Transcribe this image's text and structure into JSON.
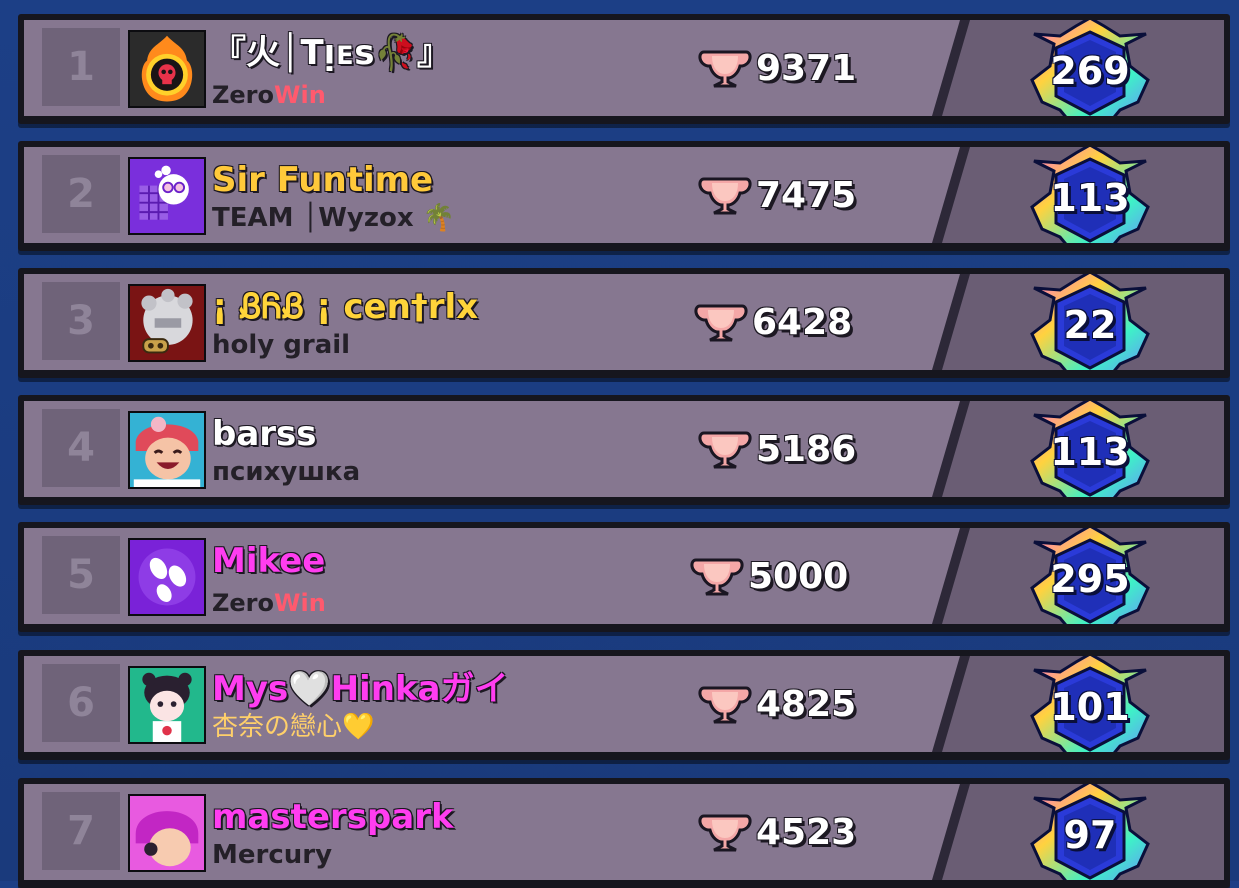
{
  "leaderboard": {
    "rows": [
      {
        "rank": "1",
        "name": "『火│Tᴉᴇs🥀』",
        "name_color": "#ffffff",
        "club": "ZeroWin",
        "club_parts": [
          "Zero",
          "Win"
        ],
        "club_colors": [
          "#242028",
          "#ff5a6e"
        ],
        "trophies": "9371",
        "level": "269",
        "avatar_icon": "flaming-skull-icon"
      },
      {
        "rank": "2",
        "name_parts": [
          "Sir ",
          "Funtime"
        ],
        "name_colors": [
          "#ffc93a",
          "#ffc93a"
        ],
        "club": "TEAM │Wyzox 🌴",
        "club_color": "#242028",
        "trophies": "7475",
        "level": "113",
        "avatar_icon": "purple-character-icon"
      },
      {
        "rank": "3",
        "name_parts": [
          "¡ ᏰᏲᏰ ¡ ",
          "cen†rlx"
        ],
        "name_colors": [
          "#ffd43a",
          "#ffd43a"
        ],
        "club": "holy grail",
        "club_color": "#242028",
        "trophies": "6428",
        "level": "22",
        "avatar_icon": "robot-brawler-icon"
      },
      {
        "rank": "4",
        "name": "barss",
        "name_color": "#ffffff",
        "club": "психушка",
        "club_color": "#242028",
        "trophies": "5186",
        "level": "113",
        "avatar_icon": "laughing-brawler-icon"
      },
      {
        "rank": "5",
        "name": "Mikee",
        "name_color": "#ff3df0",
        "club_parts": [
          "Zero",
          "Win"
        ],
        "club_colors": [
          "#242028",
          "#ff5a6e"
        ],
        "trophies": "5000",
        "level": "295",
        "avatar_icon": "footprints-icon"
      },
      {
        "rank": "6",
        "name_parts": [
          "Mys",
          "🤍",
          "Hinkaガイ"
        ],
        "name_colors": [
          "#ff3df0",
          "#ffffff",
          "#ff3df0"
        ],
        "club": "杏奈の戀心💛",
        "club_color": "#ffd06a",
        "trophies": "4825",
        "level": "101",
        "avatar_icon": "panda-girl-icon"
      },
      {
        "rank": "7",
        "name": "masterspark",
        "name_color": "#ff3df0",
        "club": "Mercury",
        "club_color": "#242028",
        "trophies": "4523",
        "level": "97",
        "avatar_icon": "pink-hair-brawler-icon"
      }
    ]
  }
}
